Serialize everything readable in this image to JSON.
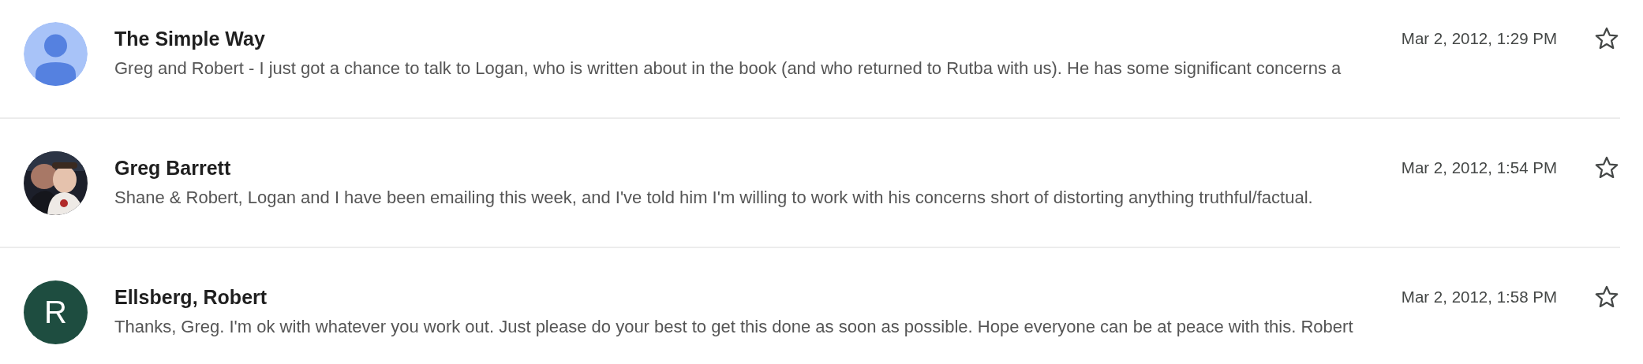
{
  "messages": [
    {
      "sender": "The Simple Way",
      "avatar": {
        "kind": "silhouette"
      },
      "date": "Mar 2, 2012, 1:29 PM",
      "snippet": "Greg and Robert - I just got a chance to talk to Logan, who is written about in the book (and who returned to Rutba with us). He has some significant concerns a",
      "starred": false
    },
    {
      "sender": "Greg Barrett",
      "date": "Mar 2, 2012, 1:54 PM",
      "snippet": "Shane & Robert, Logan and I have been emailing this week, and I've told him I'm willing to work with his concerns short of distorting anything truthful/factual.",
      "starred": false
    },
    {
      "sender": "Ellsberg, Robert",
      "avatar": {
        "kind": "letter",
        "letter": "R",
        "color": "#1e4d40"
      },
      "date": "Mar 2, 2012, 1:58 PM",
      "snippet": "Thanks, Greg. I'm ok with whatever you work out. Just please do your best to get this done as soon as possible. Hope everyone can be at peace with this. Robert",
      "starred": false
    }
  ]
}
